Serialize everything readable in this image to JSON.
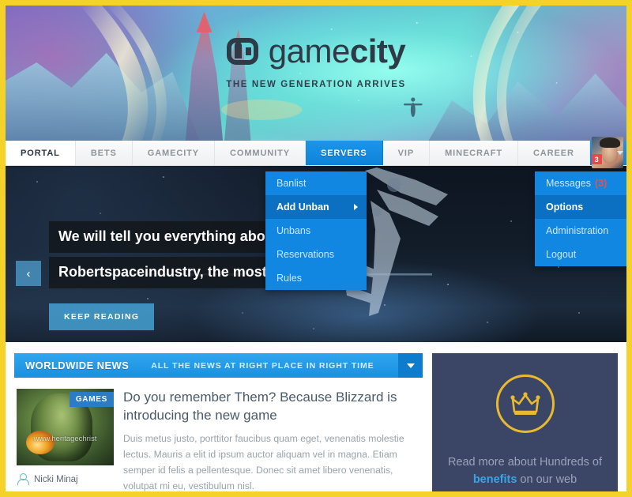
{
  "brand": {
    "logo_main": "game",
    "logo_accent": "city",
    "tagline": "THE NEW GENERATION ARRIVES"
  },
  "nav": {
    "items": [
      {
        "label": "PORTAL",
        "state": "active-light"
      },
      {
        "label": "BETS",
        "state": "default"
      },
      {
        "label": "GAMECITY",
        "state": "default"
      },
      {
        "label": "COMMUNITY",
        "state": "default"
      },
      {
        "label": "SERVERS",
        "state": "active-blue"
      },
      {
        "label": "VIP",
        "state": "default"
      },
      {
        "label": "MINECRAFT",
        "state": "default"
      },
      {
        "label": "CAREER",
        "state": "default"
      }
    ],
    "user_badge_count": "3"
  },
  "servers_menu": {
    "items": [
      {
        "label": "Banlist",
        "selected": false,
        "has_submenu": false
      },
      {
        "label": "Add Unban",
        "selected": true,
        "has_submenu": true
      },
      {
        "label": "Unbans",
        "selected": false,
        "has_submenu": false
      },
      {
        "label": "Reservations",
        "selected": false,
        "has_submenu": false
      },
      {
        "label": "Rules",
        "selected": false,
        "has_submenu": false
      }
    ]
  },
  "user_menu": {
    "items": [
      {
        "label": "Messages",
        "count": "(3)",
        "selected": false
      },
      {
        "label": "Options",
        "count": "",
        "selected": true
      },
      {
        "label": "Administration",
        "count": "",
        "selected": false
      },
      {
        "label": "Logout",
        "count": "",
        "selected": false
      }
    ]
  },
  "hero": {
    "line1": "We will tell you everything about",
    "line2": "Robertspaceindustry, the most el",
    "cta": "KEEP READING",
    "prev_arrow": "‹"
  },
  "news": {
    "title": "WORLDWIDE NEWS",
    "subtitle": "ALL THE NEWS AT RIGHT PLACE IN RIGHT TIME",
    "article": {
      "category": "GAMES",
      "watermark": "www.heritagechrist",
      "author": "Nicki Minaj",
      "title": "Do you remember Them? Because Blizzard is introducing the new game",
      "body": "Duis metus justo, porttitor faucibus quam eget, venenatis molestie lectus. Mauris a elit id ipsum auctor aliquam vel in magna. Etiam semper id felis a pellentesque. Donec sit amet libero venenatis, volutpat mi eu, vestibulum nisl."
    }
  },
  "promo": {
    "text_before": "Read more about Hundreds of ",
    "highlight": "benefits",
    "text_after": " on our web"
  },
  "colors": {
    "frame": "#f5d22a",
    "accent_blue": "#1287e2",
    "nav_blue": "#0e82da",
    "badge_red": "#e8484a",
    "promo_bg": "#3b4566",
    "crown_gold": "#e9b930"
  }
}
